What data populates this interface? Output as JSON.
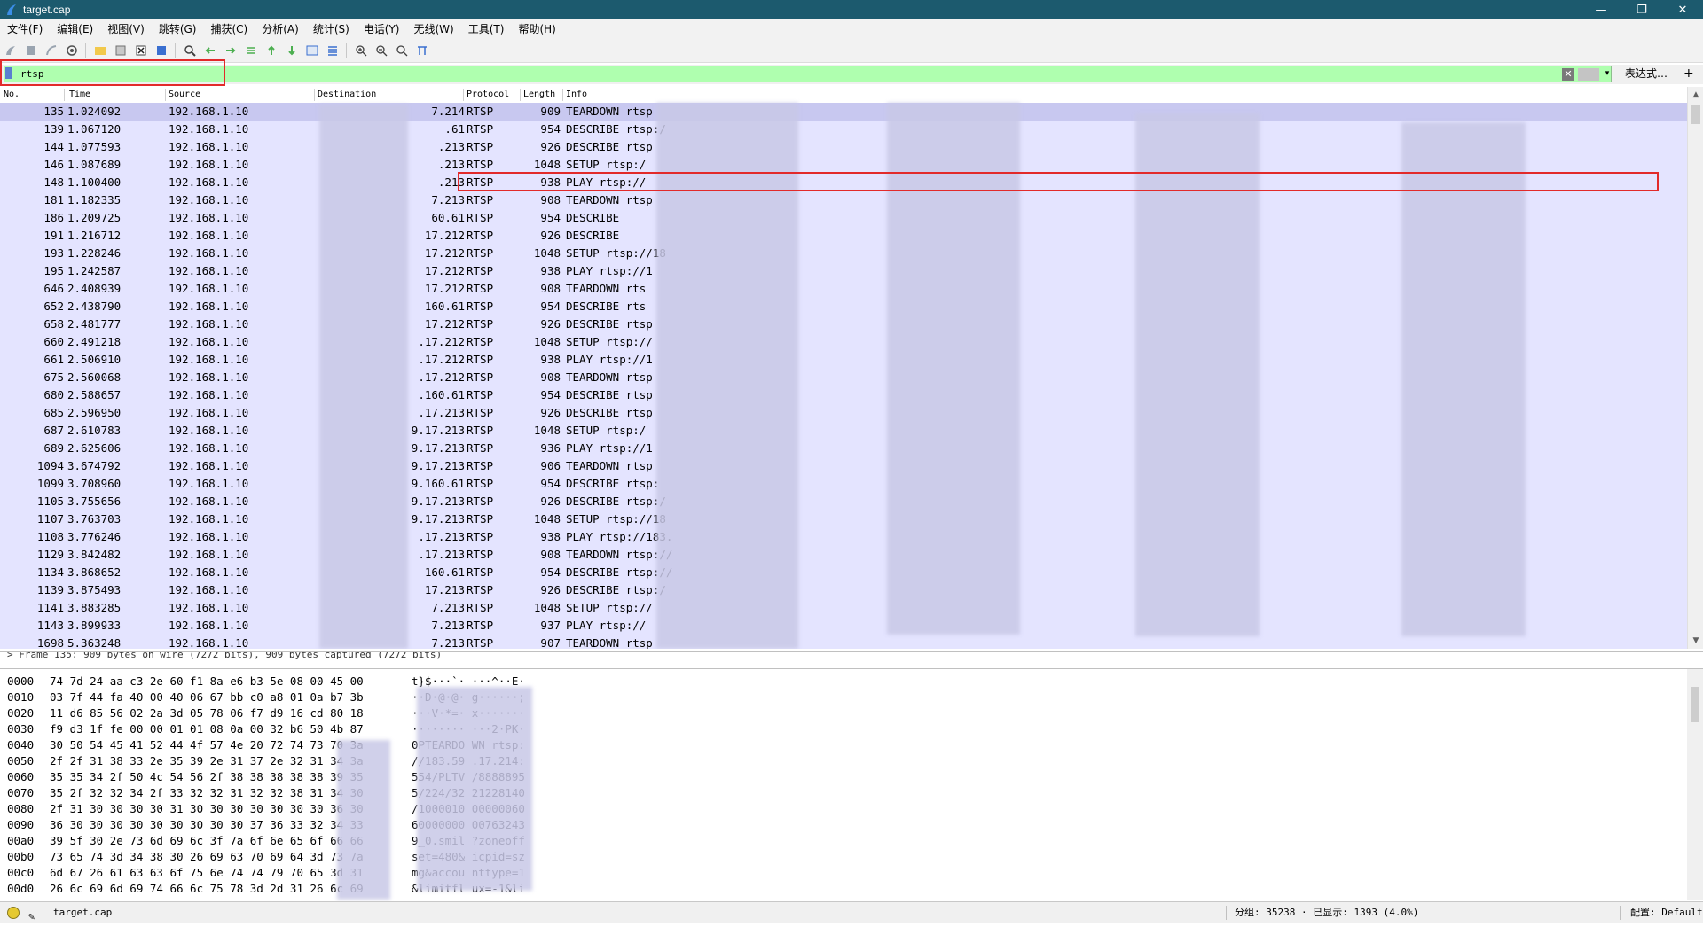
{
  "window": {
    "title": "target.cap",
    "minimize": "—",
    "restore": "❐",
    "close": "✕"
  },
  "menu": [
    "文件(F)",
    "编辑(E)",
    "视图(V)",
    "跳转(G)",
    "捕获(C)",
    "分析(A)",
    "统计(S)",
    "电话(Y)",
    "无线(W)",
    "工具(T)",
    "帮助(H)"
  ],
  "filter": {
    "value": "rtsp",
    "expression_label": "表达式…",
    "plus": "+",
    "clear": "✕",
    "dropdown": "▾"
  },
  "columns": [
    "No.",
    "Time",
    "Source",
    "Destination",
    "Protocol",
    "Length",
    "Info"
  ],
  "packets": [
    {
      "no": "135",
      "time": "1.024092",
      "src": "192.168.1.10",
      "dst": "7.214",
      "proto": "RTSP",
      "len": "909",
      "info": "TEARDOWN rtsp"
    },
    {
      "no": "139",
      "time": "1.067120",
      "src": "192.168.1.10",
      "dst": ".61",
      "proto": "RTSP",
      "len": "954",
      "info": "DESCRIBE rtsp:/"
    },
    {
      "no": "144",
      "time": "1.077593",
      "src": "192.168.1.10",
      "dst": ".213",
      "proto": "RTSP",
      "len": "926",
      "info": "DESCRIBE rtsp"
    },
    {
      "no": "146",
      "time": "1.087689",
      "src": "192.168.1.10",
      "dst": ".213",
      "proto": "RTSP",
      "len": "1048",
      "info": "SETUP rtsp:/"
    },
    {
      "no": "148",
      "time": "1.100400",
      "src": "192.168.1.10",
      "dst": ".213",
      "proto": "RTSP",
      "len": "938",
      "info": "PLAY rtsp://"
    },
    {
      "no": "181",
      "time": "1.182335",
      "src": "192.168.1.10",
      "dst": "7.213",
      "proto": "RTSP",
      "len": "908",
      "info": "TEARDOWN rtsp"
    },
    {
      "no": "186",
      "time": "1.209725",
      "src": "192.168.1.10",
      "dst": "60.61",
      "proto": "RTSP",
      "len": "954",
      "info": "DESCRIBE"
    },
    {
      "no": "191",
      "time": "1.216712",
      "src": "192.168.1.10",
      "dst": "17.212",
      "proto": "RTSP",
      "len": "926",
      "info": "DESCRIBE"
    },
    {
      "no": "193",
      "time": "1.228246",
      "src": "192.168.1.10",
      "dst": "17.212",
      "proto": "RTSP",
      "len": "1048",
      "info": "SETUP rtsp://18"
    },
    {
      "no": "195",
      "time": "1.242587",
      "src": "192.168.1.10",
      "dst": "17.212",
      "proto": "RTSP",
      "len": "938",
      "info": "PLAY rtsp://1"
    },
    {
      "no": "646",
      "time": "2.408939",
      "src": "192.168.1.10",
      "dst": "17.212",
      "proto": "RTSP",
      "len": "908",
      "info": "TEARDOWN rts"
    },
    {
      "no": "652",
      "time": "2.438790",
      "src": "192.168.1.10",
      "dst": "160.61",
      "proto": "RTSP",
      "len": "954",
      "info": "DESCRIBE rts"
    },
    {
      "no": "658",
      "time": "2.481777",
      "src": "192.168.1.10",
      "dst": "17.212",
      "proto": "RTSP",
      "len": "926",
      "info": "DESCRIBE rtsp"
    },
    {
      "no": "660",
      "time": "2.491218",
      "src": "192.168.1.10",
      "dst": ".17.212",
      "proto": "RTSP",
      "len": "1048",
      "info": "SETUP rtsp://"
    },
    {
      "no": "661",
      "time": "2.506910",
      "src": "192.168.1.10",
      "dst": ".17.212",
      "proto": "RTSP",
      "len": "938",
      "info": "PLAY rtsp://1"
    },
    {
      "no": "675",
      "time": "2.560068",
      "src": "192.168.1.10",
      "dst": ".17.212",
      "proto": "RTSP",
      "len": "908",
      "info": "TEARDOWN rtsp"
    },
    {
      "no": "680",
      "time": "2.588657",
      "src": "192.168.1.10",
      "dst": ".160.61",
      "proto": "RTSP",
      "len": "954",
      "info": "DESCRIBE rtsp"
    },
    {
      "no": "685",
      "time": "2.596950",
      "src": "192.168.1.10",
      "dst": ".17.213",
      "proto": "RTSP",
      "len": "926",
      "info": "DESCRIBE rtsp"
    },
    {
      "no": "687",
      "time": "2.610783",
      "src": "192.168.1.10",
      "dst": "9.17.213",
      "proto": "RTSP",
      "len": "1048",
      "info": "SETUP rtsp:/"
    },
    {
      "no": "689",
      "time": "2.625606",
      "src": "192.168.1.10",
      "dst": "9.17.213",
      "proto": "RTSP",
      "len": "936",
      "info": "PLAY rtsp://1"
    },
    {
      "no": "1094",
      "time": "3.674792",
      "src": "192.168.1.10",
      "dst": "9.17.213",
      "proto": "RTSP",
      "len": "906",
      "info": "TEARDOWN rtsp"
    },
    {
      "no": "1099",
      "time": "3.708960",
      "src": "192.168.1.10",
      "dst": "9.160.61",
      "proto": "RTSP",
      "len": "954",
      "info": "DESCRIBE rtsp:"
    },
    {
      "no": "1105",
      "time": "3.755656",
      "src": "192.168.1.10",
      "dst": "9.17.213",
      "proto": "RTSP",
      "len": "926",
      "info": "DESCRIBE rtsp:/"
    },
    {
      "no": "1107",
      "time": "3.763703",
      "src": "192.168.1.10",
      "dst": "9.17.213",
      "proto": "RTSP",
      "len": "1048",
      "info": "SETUP rtsp://18"
    },
    {
      "no": "1108",
      "time": "3.776246",
      "src": "192.168.1.10",
      "dst": ".17.213",
      "proto": "RTSP",
      "len": "938",
      "info": "PLAY rtsp://183."
    },
    {
      "no": "1129",
      "time": "3.842482",
      "src": "192.168.1.10",
      "dst": ".17.213",
      "proto": "RTSP",
      "len": "908",
      "info": "TEARDOWN rtsp://"
    },
    {
      "no": "1134",
      "time": "3.868652",
      "src": "192.168.1.10",
      "dst": "160.61",
      "proto": "RTSP",
      "len": "954",
      "info": "DESCRIBE rtsp://"
    },
    {
      "no": "1139",
      "time": "3.875493",
      "src": "192.168.1.10",
      "dst": "17.213",
      "proto": "RTSP",
      "len": "926",
      "info": "DESCRIBE rtsp:/"
    },
    {
      "no": "1141",
      "time": "3.883285",
      "src": "192.168.1.10",
      "dst": "7.213",
      "proto": "RTSP",
      "len": "1048",
      "info": "SETUP rtsp://"
    },
    {
      "no": "1143",
      "time": "3.899933",
      "src": "192.168.1.10",
      "dst": "7.213",
      "proto": "RTSP",
      "len": "937",
      "info": "PLAY rtsp://"
    },
    {
      "no": "1698",
      "time": "5.363248",
      "src": "192.168.1.10",
      "dst": "7.213",
      "proto": "RTSP",
      "len": "907",
      "info": "TEARDOWN rtsp"
    }
  ],
  "details_line": "> Frame 135: 909 bytes on wire (7272 bits), 909 bytes captured (7272 bits)",
  "bytes": [
    {
      "off": "0000",
      "hex": "74 7d 24 aa c3 2e 60 f1  8a e6 b3 5e 08 00 45 00",
      "asc": "t}$···`·  ···^··E·"
    },
    {
      "off": "0010",
      "hex": "03 7f 44 fa 40 00 40 06  67 bb c0 a8 01 0a b7 3b",
      "asc": "··D·@·@·  g······;"
    },
    {
      "off": "0020",
      "hex": "11 d6 85 56 02 2a 3d 05  78 06 f7 d9 16 cd 80 18",
      "asc": "···V·*=·  x·······"
    },
    {
      "off": "0030",
      "hex": "f9 d3 1f fe 00 00 01 01  08 0a 00 32 b6 50 4b 87",
      "asc": "········  ···2·PK·"
    },
    {
      "off": "0040",
      "hex": "30 50 54 45 41 52 44 4f  57 4e 20 72 74 73 70 3a",
      "asc": "0PTEARDO  WN rtsp:"
    },
    {
      "off": "0050",
      "hex": "2f 2f 31 38 33 2e 35 39  2e 31 37 2e 32 31 34 3a",
      "asc": "//183.59  .17.214:"
    },
    {
      "off": "0060",
      "hex": "35 35 34 2f 50 4c 54 56  2f 38 38 38 38 38 39 35",
      "asc": "554/PLTV  /8888895"
    },
    {
      "off": "0070",
      "hex": "35 2f 32 32 34 2f 33 32  32 31 32 32 38 31 34 30",
      "asc": "5/224/32  21228140"
    },
    {
      "off": "0080",
      "hex": "2f 31 30 30 30 30 31 30  30 30 30 30 30 30 36 30",
      "asc": "/1000010  00000060"
    },
    {
      "off": "0090",
      "hex": "36 30 30 30 30 30 30 30  30 30 37 36 33 32 34 33",
      "asc": "60000000  00763243"
    },
    {
      "off": "00a0",
      "hex": "39 5f 30 2e 73 6d 69 6c  3f 7a 6f 6e 65 6f 66 66",
      "asc": "9_0.smil  ?zoneoff"
    },
    {
      "off": "00b0",
      "hex": "73 65 74 3d 34 38 30 26  69 63 70 69 64 3d 73 7a",
      "asc": "set=480&  icpid=sz"
    },
    {
      "off": "00c0",
      "hex": "6d 67 26 61 63 63 6f 75  6e 74 74 79 70 65 3d 31",
      "asc": "mg&accou  nttype=1"
    },
    {
      "off": "00d0",
      "hex": "26 6c 69 6d 69 74 66 6c  75 78 3d 2d 31 26 6c 69",
      "asc": "&limitfl  ux=-1&li"
    }
  ],
  "status": {
    "file": "target.cap",
    "stats": "分组: 35238 · 已显示: 1393 (4.0%)",
    "profile": "配置: Default"
  }
}
